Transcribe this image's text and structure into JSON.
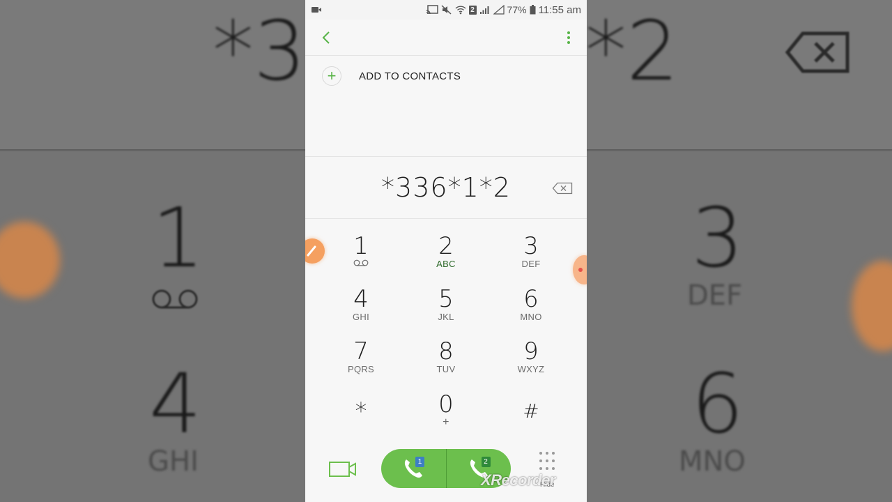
{
  "background": {
    "top_left_text": "*3",
    "top_right_text": "*2",
    "left_digit_1": "1",
    "left_digit_2": "4",
    "left_letters_2": "GHI",
    "right_digit_1": "3",
    "right_letters_1": "DEF",
    "right_digit_2": "6",
    "right_letters_2": "MNO"
  },
  "status_bar": {
    "sim_badge": "2",
    "battery": "77%",
    "time": "11:55 am"
  },
  "header": {
    "back_icon": "chevron-left-icon",
    "menu_icon": "more-vert-icon"
  },
  "add_contacts": {
    "icon": "plus-icon",
    "label": "ADD TO CONTACTS"
  },
  "dialer": {
    "entered_number": "*336*1*2",
    "keys": [
      {
        "digit": "1",
        "letters": ""
      },
      {
        "digit": "2",
        "letters": "ABC"
      },
      {
        "digit": "3",
        "letters": "DEF"
      },
      {
        "digit": "4",
        "letters": "GHI"
      },
      {
        "digit": "5",
        "letters": "JKL"
      },
      {
        "digit": "6",
        "letters": "MNO"
      },
      {
        "digit": "7",
        "letters": "PQRS"
      },
      {
        "digit": "8",
        "letters": "TUV"
      },
      {
        "digit": "9",
        "letters": "WXYZ"
      },
      {
        "digit": "*",
        "letters": ""
      },
      {
        "digit": "0",
        "letters": "+"
      },
      {
        "digit": "#",
        "letters": ""
      }
    ]
  },
  "bottom": {
    "call_sim1_badge": "1",
    "call_sim2_badge": "2",
    "hide_label": "Hide",
    "watermark": "XRecorder"
  },
  "colors": {
    "accent_green": "#58b448",
    "call_green": "#6cbf4d",
    "sim1_blue": "#3d7fc4",
    "sim2_green": "#2f8a3a"
  }
}
